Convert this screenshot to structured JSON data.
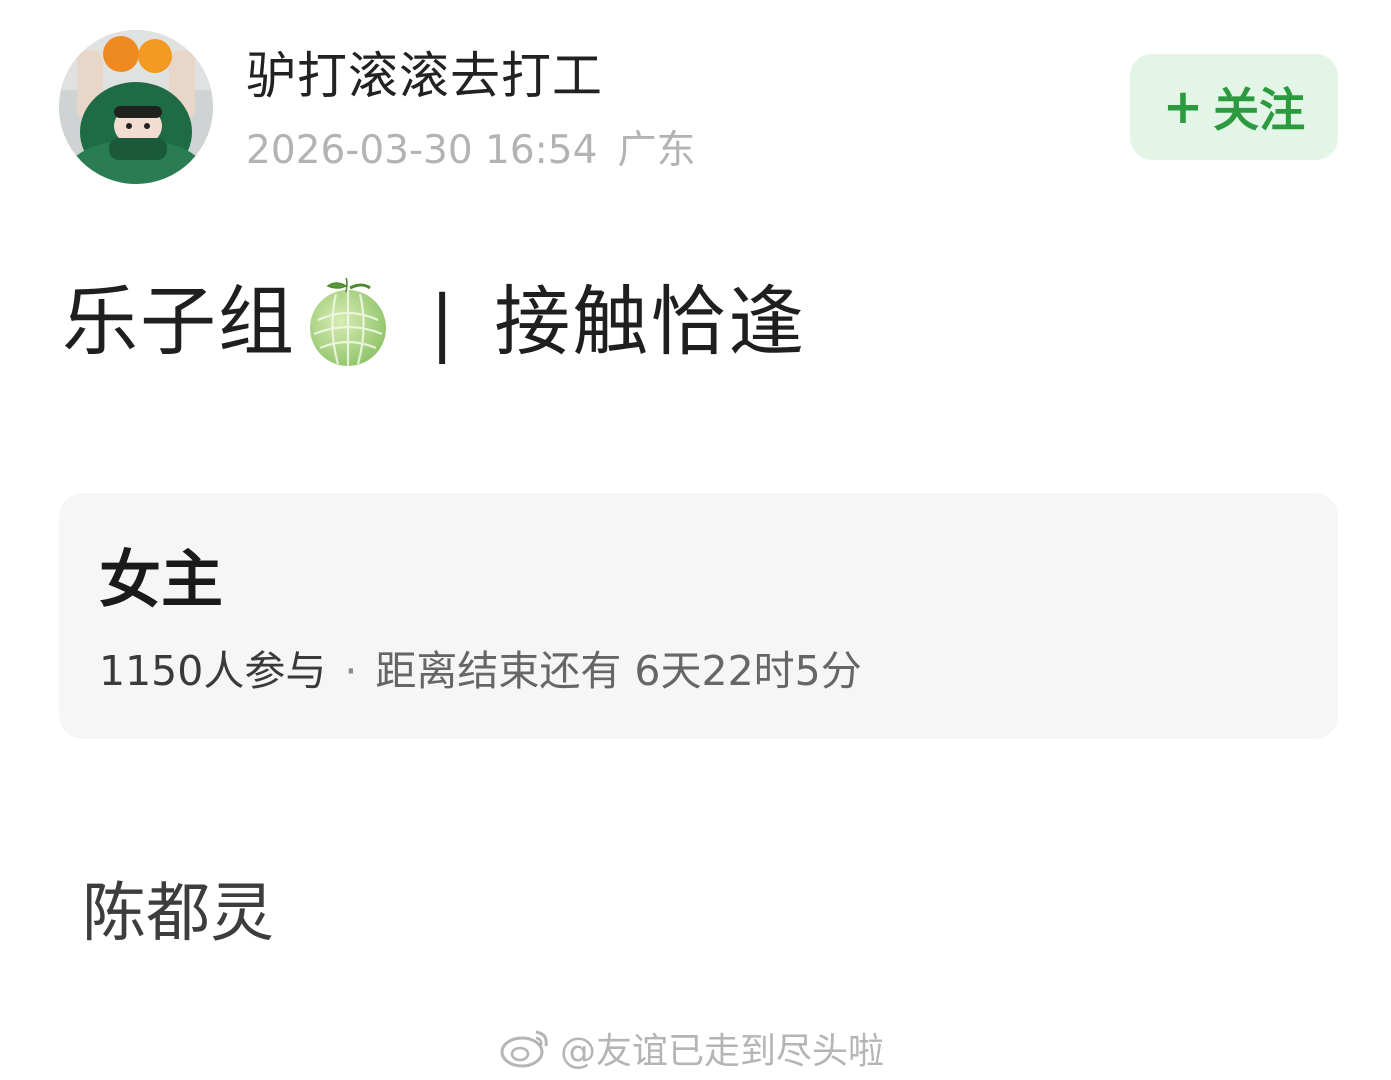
{
  "header": {
    "username": "驴打滚滚去打工",
    "date": "2026-03-30 16:54",
    "location": "广东",
    "follow_plus": "+",
    "follow_label": "关注"
  },
  "post": {
    "title_left": "乐子组",
    "emoji": "melon-emoji",
    "separator": "|",
    "title_right": "接触恰逢"
  },
  "poll": {
    "title": "女主",
    "participants": "1150人参与",
    "dot": "·",
    "countdown": "距离结束还有 6天22时5分",
    "options": [
      "陈都灵"
    ]
  },
  "watermark": {
    "text": "@友谊已走到尽头啦",
    "icon": "weibo-logo-icon"
  },
  "colors": {
    "accent_green": "#2c9b3f",
    "follow_bg": "#e3f5e6",
    "card_bg": "#f6f6f6",
    "meta_gray": "#b3b3b3"
  }
}
